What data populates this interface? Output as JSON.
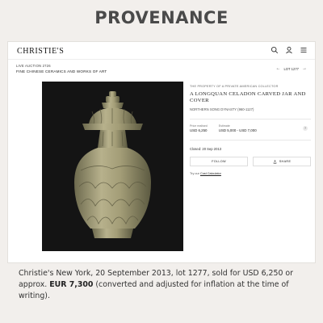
{
  "page": {
    "heading": "PROVENANCE",
    "caption_text": "Christie's New York, 20 September 2013, lot 1277, sold for USD 6,250 or approx.",
    "caption_bold": "EUR 7,300",
    "caption_tail": " (converted and adjusted for inflation at the time of writing)."
  },
  "header": {
    "logo": "CHRISTIE'S",
    "icons": [
      "search-icon",
      "user-icon",
      "menu-icon"
    ]
  },
  "sale": {
    "type": "LIVE AUCTION 2726",
    "name": "FINE CHINESE CERAMICS AND WORKS OF ART",
    "lot_label": "LOT 1277"
  },
  "lot": {
    "provenance_note": "THE PROPERTY OF A PRIVATE AMERICAN COLLECTOR",
    "title": "A LONGQUAN CELADON CARVED JAR AND COVER",
    "dynasty": "NORTHERN SONG DYNASTY (960-1127)",
    "price_label": "Price realised",
    "price_value": "USD 6,250",
    "estimate_label": "Estimate",
    "estimate_value": "USD 5,000 - USD 7,000",
    "info": "?",
    "closed": "Closed: 20 Sep 2013",
    "follow_label": "FOLLOW",
    "share_label": "SHARE",
    "cost_prefix": "Try our",
    "cost_link": "Cost Calculator"
  },
  "colors": {
    "background": "#f2efec",
    "photo_background": "#141414",
    "celadon": "#a8a27c"
  }
}
